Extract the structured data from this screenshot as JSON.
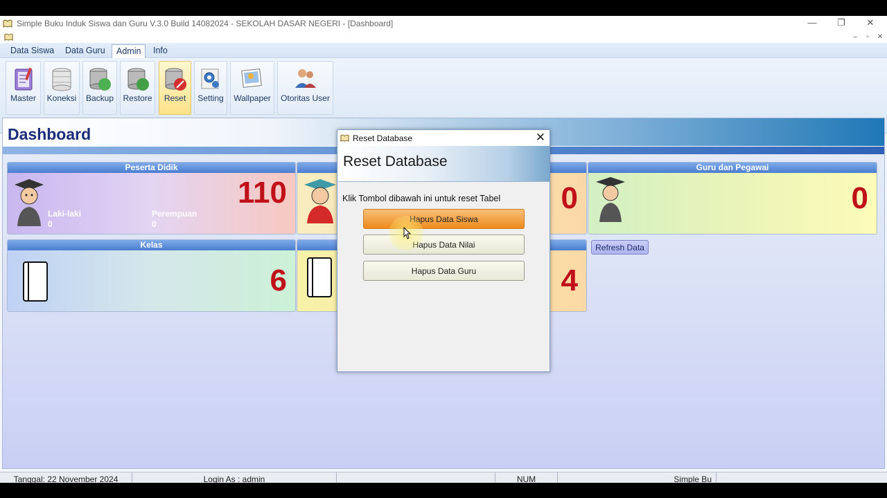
{
  "window": {
    "title": "Simple Buku Induk Siswa dan Guru V.3.0 Build 14082024 - SEKOLAH DASAR NEGERI - [Dashboard]",
    "minimize": "—",
    "restore": "❐",
    "close": "✕",
    "mdi_min": "–",
    "mdi_restore": "▫",
    "mdi_close": "✕"
  },
  "menu": {
    "tabs": [
      {
        "label": "Data Siswa",
        "active": false
      },
      {
        "label": "Data Guru",
        "active": false
      },
      {
        "label": "Admin",
        "active": true
      },
      {
        "label": "Info",
        "active": false
      }
    ]
  },
  "ribbon": {
    "buttons": [
      {
        "label": "Master",
        "icon": "notebook-icon"
      },
      {
        "label": "Koneksi",
        "icon": "database-icon"
      },
      {
        "label": "Backup",
        "icon": "database-backup-icon"
      },
      {
        "label": "Restore",
        "icon": "database-restore-icon"
      },
      {
        "label": "Reset",
        "icon": "database-reset-icon",
        "active": true
      },
      {
        "label": "Setting",
        "icon": "gear-icon"
      },
      {
        "label": "Wallpaper",
        "icon": "wallpaper-icon"
      },
      {
        "label": "Otoritas User",
        "icon": "users-icon"
      }
    ]
  },
  "dashboard": {
    "title": "Dashboard",
    "cards": {
      "peserta_didik": {
        "title": "Peserta Didik",
        "value": "110",
        "male_label": "Laki-laki",
        "male_value": "0",
        "female_label": "Perempuan",
        "female_value": "0"
      },
      "guru": {
        "title": "Guru dan Pegawai",
        "value": "0"
      },
      "kelas": {
        "title": "Kelas",
        "value": "6"
      },
      "mid_top_value": "0",
      "mid_bottom_value": "4"
    },
    "refresh_label": "Refresh Data"
  },
  "dialog": {
    "title": "Reset Database",
    "banner_title": "Reset Database",
    "message": "Klik Tombol dibawah ini untuk reset Tabel",
    "buttons": [
      "Hapus Data Siswa",
      "Hapus Data Nilai",
      "Hapus Data Guru"
    ],
    "close": "✕"
  },
  "status": {
    "date": "Tanggal: 22 November 2024",
    "login": "Login As : admin",
    "num": "NUM",
    "app": "Simple Bu"
  },
  "colors": {
    "accent": "#1f78b6",
    "value_red": "#c0101a"
  }
}
